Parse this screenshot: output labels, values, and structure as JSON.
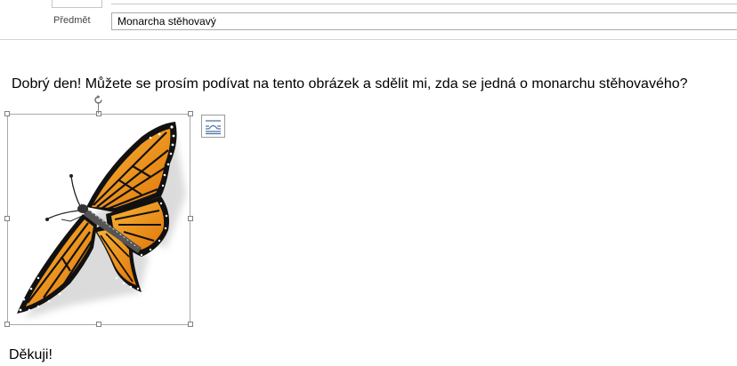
{
  "header": {
    "subject_label": "Předmět",
    "subject_value": "Monarcha stěhovavý"
  },
  "body": {
    "message": "Dobrý den! Můžete se prosím podívat na tento obrázek a sdělit mi, zda se jedná o monarchu stěhovavého?",
    "closing": "Děkuji!"
  },
  "image": {
    "icon": "butterfly-icon",
    "colors": {
      "wing_orange": "#f08a0c",
      "wing_light": "#f6b235",
      "vein_black": "#111111",
      "spot_white": "#ffffff",
      "shadow": "#bfbfbf"
    }
  },
  "controls": {
    "layout_options_icon": "layout-options-icon",
    "rotate_icon": "rotate-handle-icon"
  }
}
